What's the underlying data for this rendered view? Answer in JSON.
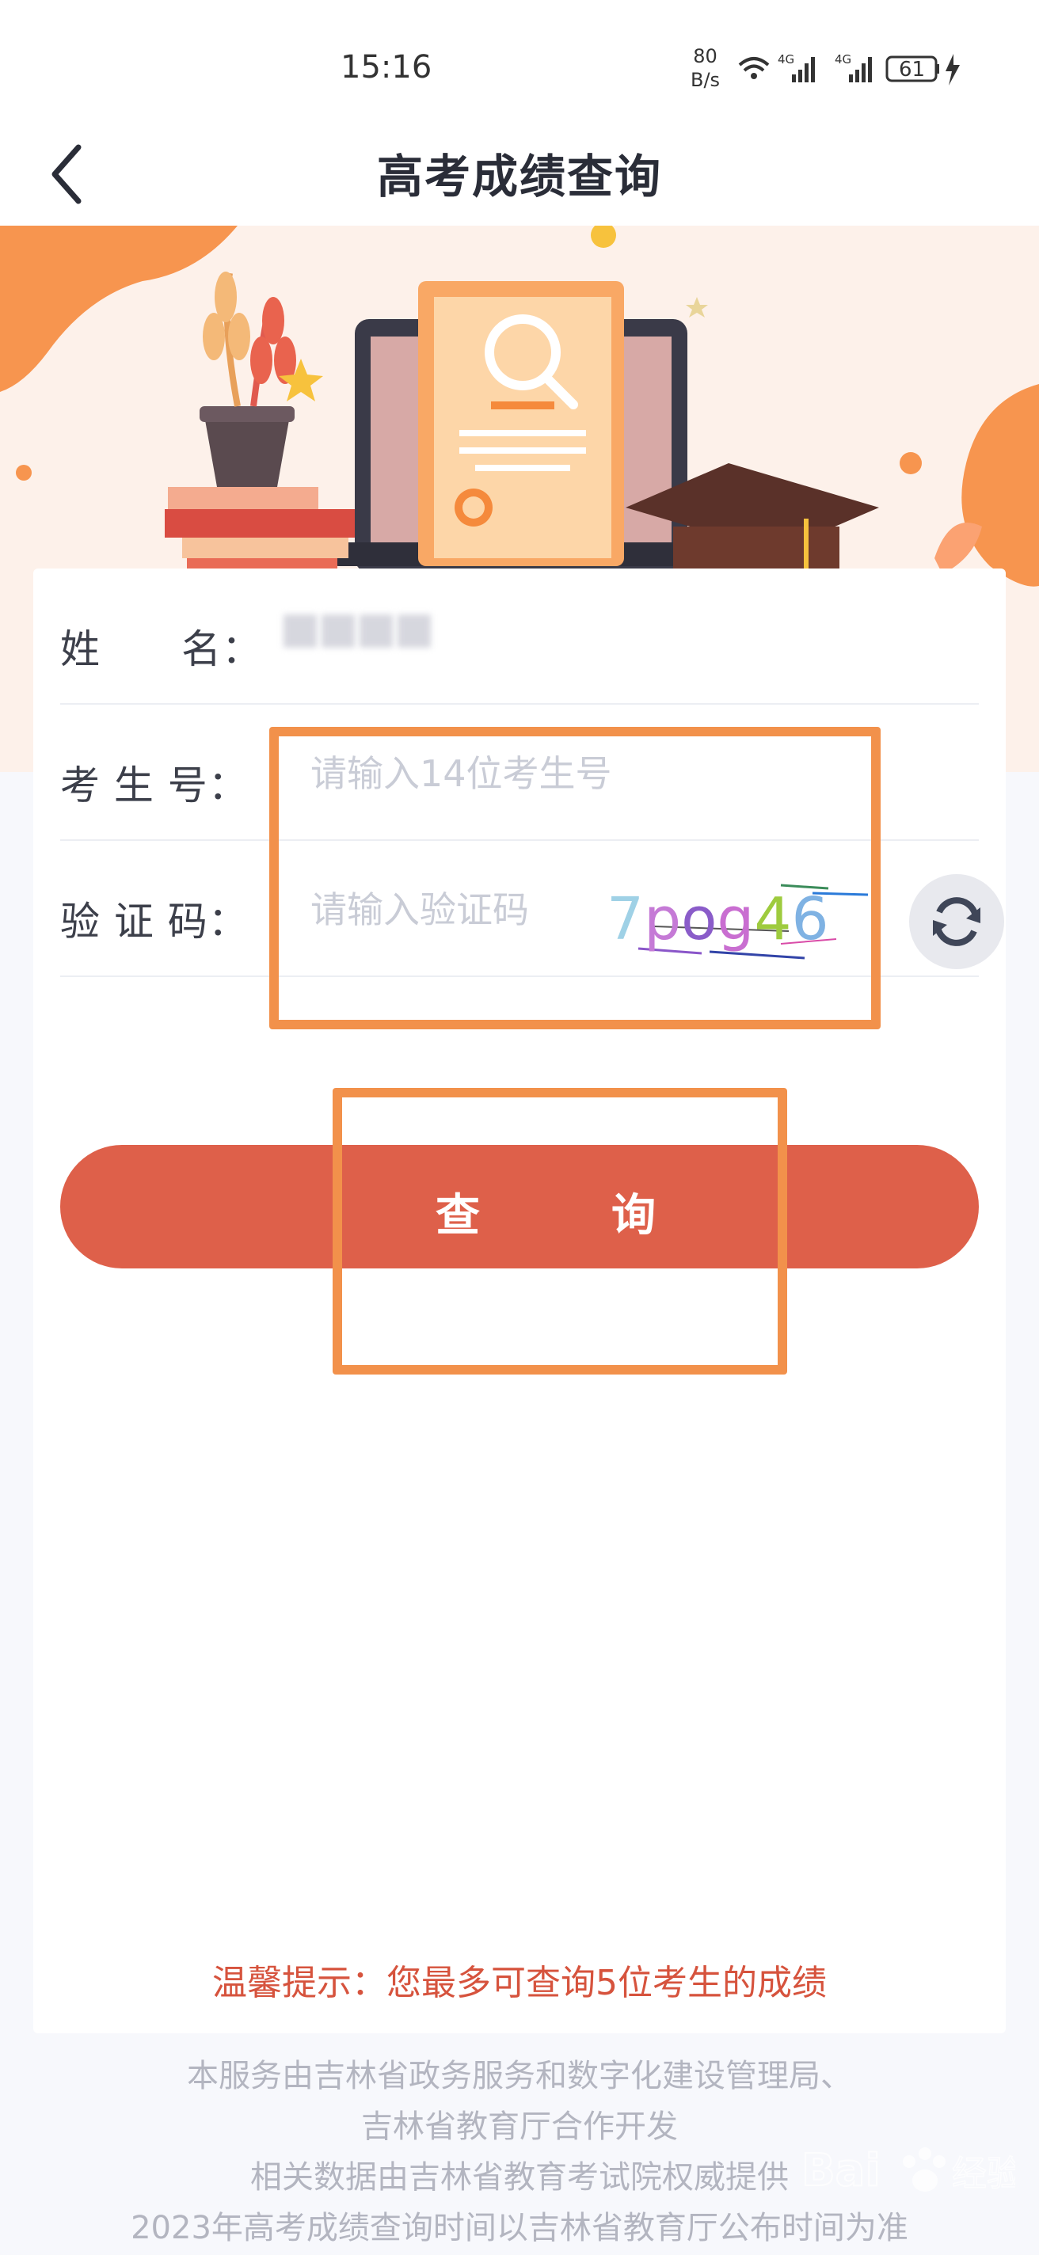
{
  "status_bar": {
    "time": "15:16",
    "net_speed_value": "80",
    "net_speed_unit": "B/s",
    "signal1_label": "4G",
    "signal2_label": "4G",
    "battery": "61"
  },
  "header": {
    "title": "高考成绩查询"
  },
  "form": {
    "name_label": "姓　　名：",
    "id_label": "考 生 号：",
    "id_placeholder": "请输入14位考生号",
    "captcha_label": "验 证 码：",
    "captcha_placeholder": "请输入验证码",
    "captcha_text": "7pog46",
    "query_button_char1": "查",
    "query_button_char2": "询",
    "tip": "温馨提示：您最多可查询5位考生的成绩"
  },
  "footer": {
    "line1": "本服务由吉林省政务服务和数字化建设管理局、",
    "line2": "吉林省教育厅合作开发",
    "line3": "相关数据由吉林省教育考试院权威提供",
    "line4": "2023年高考成绩查询时间以吉林省教育厅公布时间为准"
  },
  "watermark": {
    "text": "Bai",
    "text2": "经验"
  },
  "colors": {
    "accent_orange": "#f2914b",
    "query_button": "#de604a",
    "tip_red": "#d6533d"
  }
}
